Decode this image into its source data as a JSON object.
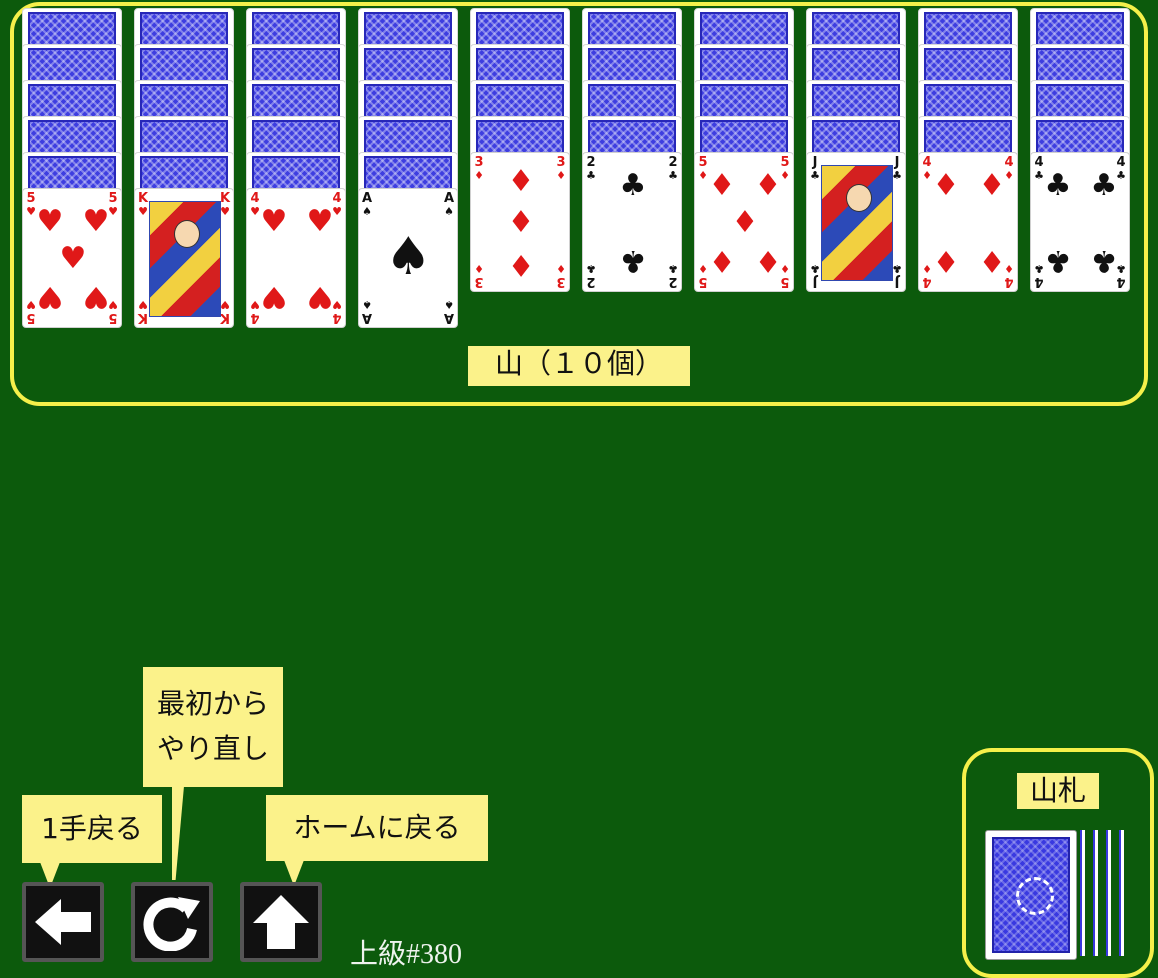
{
  "tableau_label": "山（１０個）",
  "stock_label": "山札",
  "game_id": "上級#380",
  "colors": {
    "felt": "#0c5a0c",
    "frame": "#f5f04a",
    "label_bg": "#fbf28a",
    "card_back": "#3e3ee0"
  },
  "controls": {
    "undo": {
      "tooltip": "1手戻る",
      "icon": "arrow-left-icon"
    },
    "restart": {
      "tooltip_line1": "最初から",
      "tooltip_line2": "やり直し",
      "icon": "restart-icon"
    },
    "home": {
      "tooltip": "ホームに戻る",
      "icon": "arrow-up-icon"
    }
  },
  "columns": [
    {
      "face_down": 5,
      "top": {
        "rank": "5",
        "suit": "♥"
      }
    },
    {
      "face_down": 5,
      "top": {
        "rank": "K",
        "suit": "♥"
      }
    },
    {
      "face_down": 5,
      "top": {
        "rank": "4",
        "suit": "♥"
      }
    },
    {
      "face_down": 5,
      "top": {
        "rank": "A",
        "suit": "♠"
      }
    },
    {
      "face_down": 4,
      "top": {
        "rank": "3",
        "suit": "♦"
      }
    },
    {
      "face_down": 4,
      "top": {
        "rank": "2",
        "suit": "♣"
      }
    },
    {
      "face_down": 4,
      "top": {
        "rank": "5",
        "suit": "♦"
      }
    },
    {
      "face_down": 4,
      "top": {
        "rank": "J",
        "suit": "♣"
      }
    },
    {
      "face_down": 4,
      "top": {
        "rank": "4",
        "suit": "♦"
      }
    },
    {
      "face_down": 4,
      "top": {
        "rank": "4",
        "suit": "♣"
      }
    }
  ]
}
